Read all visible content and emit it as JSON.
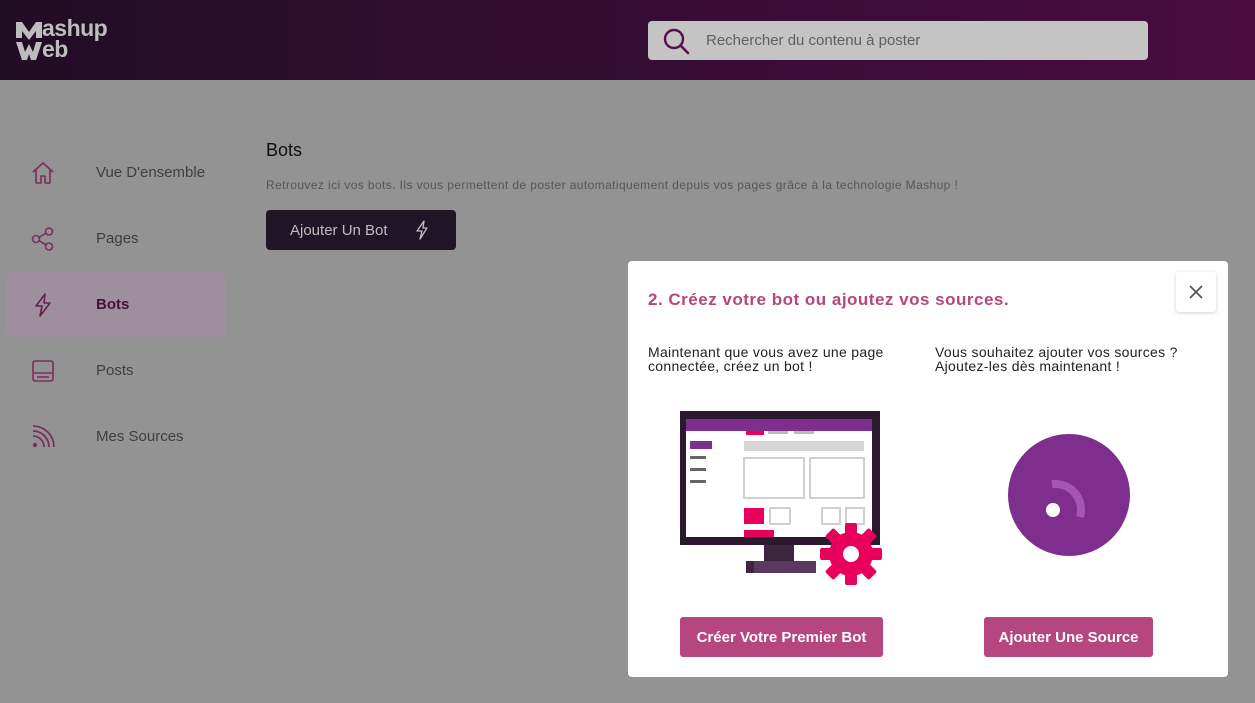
{
  "header": {
    "logo_line1": "ashup",
    "logo_line2": "eb",
    "search_placeholder": "Rechercher du contenu à poster"
  },
  "sidebar": {
    "items": [
      {
        "label": "Vue D'ensemble",
        "icon": "home-icon",
        "active": false
      },
      {
        "label": "Pages",
        "icon": "share-icon",
        "active": false
      },
      {
        "label": "Bots",
        "icon": "bolt-icon",
        "active": true
      },
      {
        "label": "Posts",
        "icon": "post-icon",
        "active": false
      },
      {
        "label": "Mes Sources",
        "icon": "rss-icon",
        "active": false
      }
    ]
  },
  "main": {
    "title": "Bots",
    "description": "Retrouvez ici vos bots. Ils vous permettent de poster automatiquement depuis vos pages grâce à la technologie Mashup !",
    "add_bot_label": "Ajouter Un Bot"
  },
  "modal": {
    "title": "2. Créez votre bot ou ajoutez vos sources.",
    "left_text": "Maintenant que vous avez une page connectée, créez un bot !",
    "right_text": "Vous souhaitez ajouter vos sources ? Ajoutez-les dès maintenant !",
    "create_bot_label": "Créer Votre Premier Bot",
    "add_source_label": "Ajouter Une Source"
  },
  "colors": {
    "accent": "#b5467f",
    "header_dark": "#210d24",
    "overlay": "#939393",
    "purple": "#7e2f8e",
    "pink": "#e8005c"
  }
}
